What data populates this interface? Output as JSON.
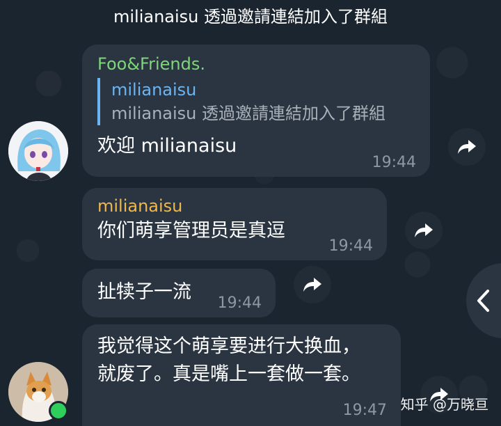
{
  "colors": {
    "background": "#1b2530",
    "bubble": "#2a3541",
    "sender_group": "#7ed67a",
    "sender_user": "#f0b84a",
    "reply_accent": "#6cb5f3",
    "time": "#8d98a3",
    "online": "#2fcf5c"
  },
  "service_message": "milianaisu 透過邀請連結加入了群組",
  "messages": [
    {
      "sender": "Foo&Friends.",
      "reply": {
        "name": "milianaisu",
        "text": "milianaisu 透過邀請連結加入了群組"
      },
      "text": "欢迎 milianaisu",
      "time": "19:44"
    },
    {
      "sender": "milianaisu",
      "text": "你们萌享管理员是真逗",
      "time": "19:44"
    },
    {
      "text": "扯犊子一流",
      "time": "19:44"
    },
    {
      "text": "我觉得这个萌享要进行大换血，就废了。真是嘴上一套做一套。",
      "time": "19:47"
    }
  ],
  "icons": {
    "forward": "forward-arrow-icon",
    "scroll": "chevron-left-icon"
  },
  "watermark": "知乎 @万晓亘"
}
